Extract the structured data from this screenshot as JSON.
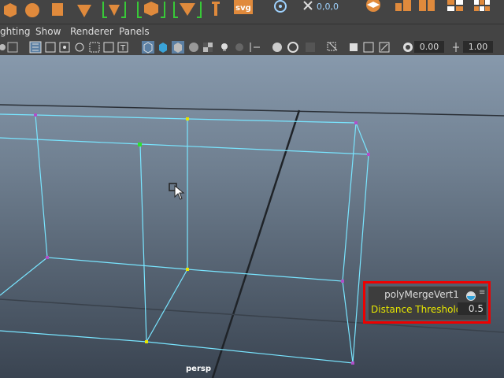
{
  "shelf": {
    "icons": [
      "cube-icon",
      "sphere-icon",
      "shape-icon",
      "shape-icon",
      "bracket-icon",
      "cube-icon",
      "bracket-icon",
      "arrow-icon",
      "text-tool-icon",
      "svg-icon",
      "gizmo-icon",
      "axis-icon",
      "grid-icon",
      "cube-icon",
      "cube-icon",
      "cube-icon",
      "cube-icon"
    ],
    "svg_label": "svg",
    "coord_label": "0,0,0"
  },
  "menubar": {
    "items": [
      "ghting",
      "Show",
      "Renderer",
      "Panels"
    ]
  },
  "panelbar": {
    "field1": "0.00",
    "field2": "1.00"
  },
  "viewport": {
    "camera_label": "persp",
    "background_top": "#8395a8",
    "background_bottom": "#3d4754",
    "wire_color": "#79e5ff"
  },
  "hud": {
    "title": "polyMergeVert1",
    "param_label": "Distance Threshold",
    "param_value": "0.5",
    "menu_glyph": "≡"
  }
}
